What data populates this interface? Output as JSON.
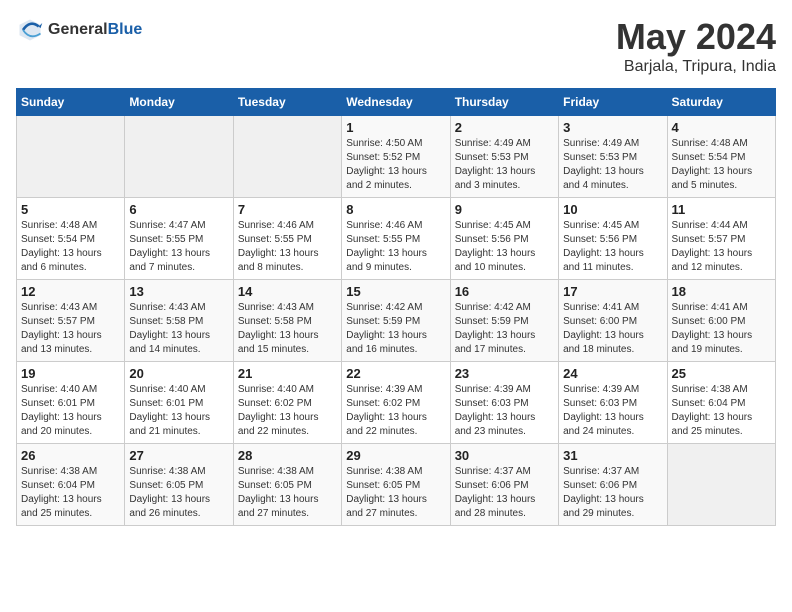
{
  "logo": {
    "text_general": "General",
    "text_blue": "Blue"
  },
  "title": "May 2024",
  "subtitle": "Barjala, Tripura, India",
  "days_of_week": [
    "Sunday",
    "Monday",
    "Tuesday",
    "Wednesday",
    "Thursday",
    "Friday",
    "Saturday"
  ],
  "weeks": [
    [
      {
        "day": "",
        "info": ""
      },
      {
        "day": "",
        "info": ""
      },
      {
        "day": "",
        "info": ""
      },
      {
        "day": "1",
        "info": "Sunrise: 4:50 AM\nSunset: 5:52 PM\nDaylight: 13 hours\nand 2 minutes."
      },
      {
        "day": "2",
        "info": "Sunrise: 4:49 AM\nSunset: 5:53 PM\nDaylight: 13 hours\nand 3 minutes."
      },
      {
        "day": "3",
        "info": "Sunrise: 4:49 AM\nSunset: 5:53 PM\nDaylight: 13 hours\nand 4 minutes."
      },
      {
        "day": "4",
        "info": "Sunrise: 4:48 AM\nSunset: 5:54 PM\nDaylight: 13 hours\nand 5 minutes."
      }
    ],
    [
      {
        "day": "5",
        "info": "Sunrise: 4:48 AM\nSunset: 5:54 PM\nDaylight: 13 hours\nand 6 minutes."
      },
      {
        "day": "6",
        "info": "Sunrise: 4:47 AM\nSunset: 5:55 PM\nDaylight: 13 hours\nand 7 minutes."
      },
      {
        "day": "7",
        "info": "Sunrise: 4:46 AM\nSunset: 5:55 PM\nDaylight: 13 hours\nand 8 minutes."
      },
      {
        "day": "8",
        "info": "Sunrise: 4:46 AM\nSunset: 5:55 PM\nDaylight: 13 hours\nand 9 minutes."
      },
      {
        "day": "9",
        "info": "Sunrise: 4:45 AM\nSunset: 5:56 PM\nDaylight: 13 hours\nand 10 minutes."
      },
      {
        "day": "10",
        "info": "Sunrise: 4:45 AM\nSunset: 5:56 PM\nDaylight: 13 hours\nand 11 minutes."
      },
      {
        "day": "11",
        "info": "Sunrise: 4:44 AM\nSunset: 5:57 PM\nDaylight: 13 hours\nand 12 minutes."
      }
    ],
    [
      {
        "day": "12",
        "info": "Sunrise: 4:43 AM\nSunset: 5:57 PM\nDaylight: 13 hours\nand 13 minutes."
      },
      {
        "day": "13",
        "info": "Sunrise: 4:43 AM\nSunset: 5:58 PM\nDaylight: 13 hours\nand 14 minutes."
      },
      {
        "day": "14",
        "info": "Sunrise: 4:43 AM\nSunset: 5:58 PM\nDaylight: 13 hours\nand 15 minutes."
      },
      {
        "day": "15",
        "info": "Sunrise: 4:42 AM\nSunset: 5:59 PM\nDaylight: 13 hours\nand 16 minutes."
      },
      {
        "day": "16",
        "info": "Sunrise: 4:42 AM\nSunset: 5:59 PM\nDaylight: 13 hours\nand 17 minutes."
      },
      {
        "day": "17",
        "info": "Sunrise: 4:41 AM\nSunset: 6:00 PM\nDaylight: 13 hours\nand 18 minutes."
      },
      {
        "day": "18",
        "info": "Sunrise: 4:41 AM\nSunset: 6:00 PM\nDaylight: 13 hours\nand 19 minutes."
      }
    ],
    [
      {
        "day": "19",
        "info": "Sunrise: 4:40 AM\nSunset: 6:01 PM\nDaylight: 13 hours\nand 20 minutes."
      },
      {
        "day": "20",
        "info": "Sunrise: 4:40 AM\nSunset: 6:01 PM\nDaylight: 13 hours\nand 21 minutes."
      },
      {
        "day": "21",
        "info": "Sunrise: 4:40 AM\nSunset: 6:02 PM\nDaylight: 13 hours\nand 22 minutes."
      },
      {
        "day": "22",
        "info": "Sunrise: 4:39 AM\nSunset: 6:02 PM\nDaylight: 13 hours\nand 22 minutes."
      },
      {
        "day": "23",
        "info": "Sunrise: 4:39 AM\nSunset: 6:03 PM\nDaylight: 13 hours\nand 23 minutes."
      },
      {
        "day": "24",
        "info": "Sunrise: 4:39 AM\nSunset: 6:03 PM\nDaylight: 13 hours\nand 24 minutes."
      },
      {
        "day": "25",
        "info": "Sunrise: 4:38 AM\nSunset: 6:04 PM\nDaylight: 13 hours\nand 25 minutes."
      }
    ],
    [
      {
        "day": "26",
        "info": "Sunrise: 4:38 AM\nSunset: 6:04 PM\nDaylight: 13 hours\nand 25 minutes."
      },
      {
        "day": "27",
        "info": "Sunrise: 4:38 AM\nSunset: 6:05 PM\nDaylight: 13 hours\nand 26 minutes."
      },
      {
        "day": "28",
        "info": "Sunrise: 4:38 AM\nSunset: 6:05 PM\nDaylight: 13 hours\nand 27 minutes."
      },
      {
        "day": "29",
        "info": "Sunrise: 4:38 AM\nSunset: 6:05 PM\nDaylight: 13 hours\nand 27 minutes."
      },
      {
        "day": "30",
        "info": "Sunrise: 4:37 AM\nSunset: 6:06 PM\nDaylight: 13 hours\nand 28 minutes."
      },
      {
        "day": "31",
        "info": "Sunrise: 4:37 AM\nSunset: 6:06 PM\nDaylight: 13 hours\nand 29 minutes."
      },
      {
        "day": "",
        "info": ""
      }
    ]
  ]
}
